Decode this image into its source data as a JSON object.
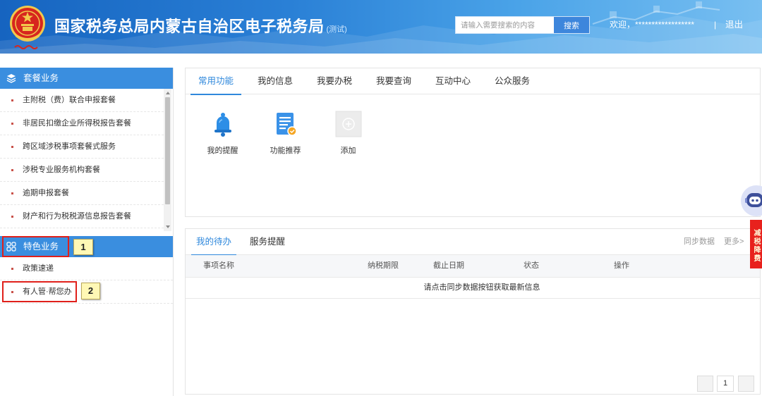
{
  "colors": {
    "accent": "#2f88dc",
    "sidebar_header": "#3a8edf",
    "banner_dark": "#1664c0",
    "banner_light": "#78bff1",
    "annotation_red": "#e0201b",
    "annotation_yellow": "#fff8b5",
    "promo_red": "#e8211d"
  },
  "header": {
    "emblem_icon": "tax-emblem-icon",
    "title": "国家税务总局内蒙古自治区电子税务局",
    "title_suffix": "(测试)",
    "search": {
      "placeholder": "请输入需要搜索的内容",
      "button": "搜索"
    },
    "welcome": "欢迎，******************",
    "separator": "|",
    "logout": "退出"
  },
  "sidebar": {
    "sections": [
      {
        "title": "套餐业务",
        "icon": "layers-icon",
        "items": [
          "主附税（费）联合申报套餐",
          "非居民扣缴企业所得税报告套餐",
          "跨区域涉税事项套餐式服务",
          "涉税专业服务机构套餐",
          "逾期申报套餐",
          "财产和行为税税源信息报告套餐"
        ]
      },
      {
        "title": "特色业务",
        "icon": "grid-icon",
        "items": [
          "政策速递",
          "有人管·帮您办"
        ]
      }
    ]
  },
  "main": {
    "tabs": [
      {
        "label": "常用功能",
        "active": true
      },
      {
        "label": "我的信息",
        "active": false
      },
      {
        "label": "我要办税",
        "active": false
      },
      {
        "label": "我要查询",
        "active": false
      },
      {
        "label": "互动中心",
        "active": false
      },
      {
        "label": "公众服务",
        "active": false
      }
    ],
    "functions": [
      {
        "label": "我的提醒",
        "icon": "bell-icon"
      },
      {
        "label": "功能推荐",
        "icon": "recommend-icon"
      },
      {
        "label": "添加",
        "icon": "add-icon"
      }
    ]
  },
  "todo": {
    "tabs": [
      {
        "label": "我的待办",
        "active": true
      },
      {
        "label": "服务提醒",
        "active": false
      }
    ],
    "sync": "同步数据",
    "more": "更多>",
    "columns": [
      "事项名称",
      "纳税期限",
      "截止日期",
      "状态",
      "操作"
    ],
    "empty_message": "请点击同步数据按钮获取最新信息",
    "pagination": {
      "current_page": "1"
    }
  },
  "float": {
    "assistant_icon": "robot-icon",
    "promo": "减税降费"
  },
  "annotations": [
    {
      "label": "1"
    },
    {
      "label": "2"
    }
  ]
}
